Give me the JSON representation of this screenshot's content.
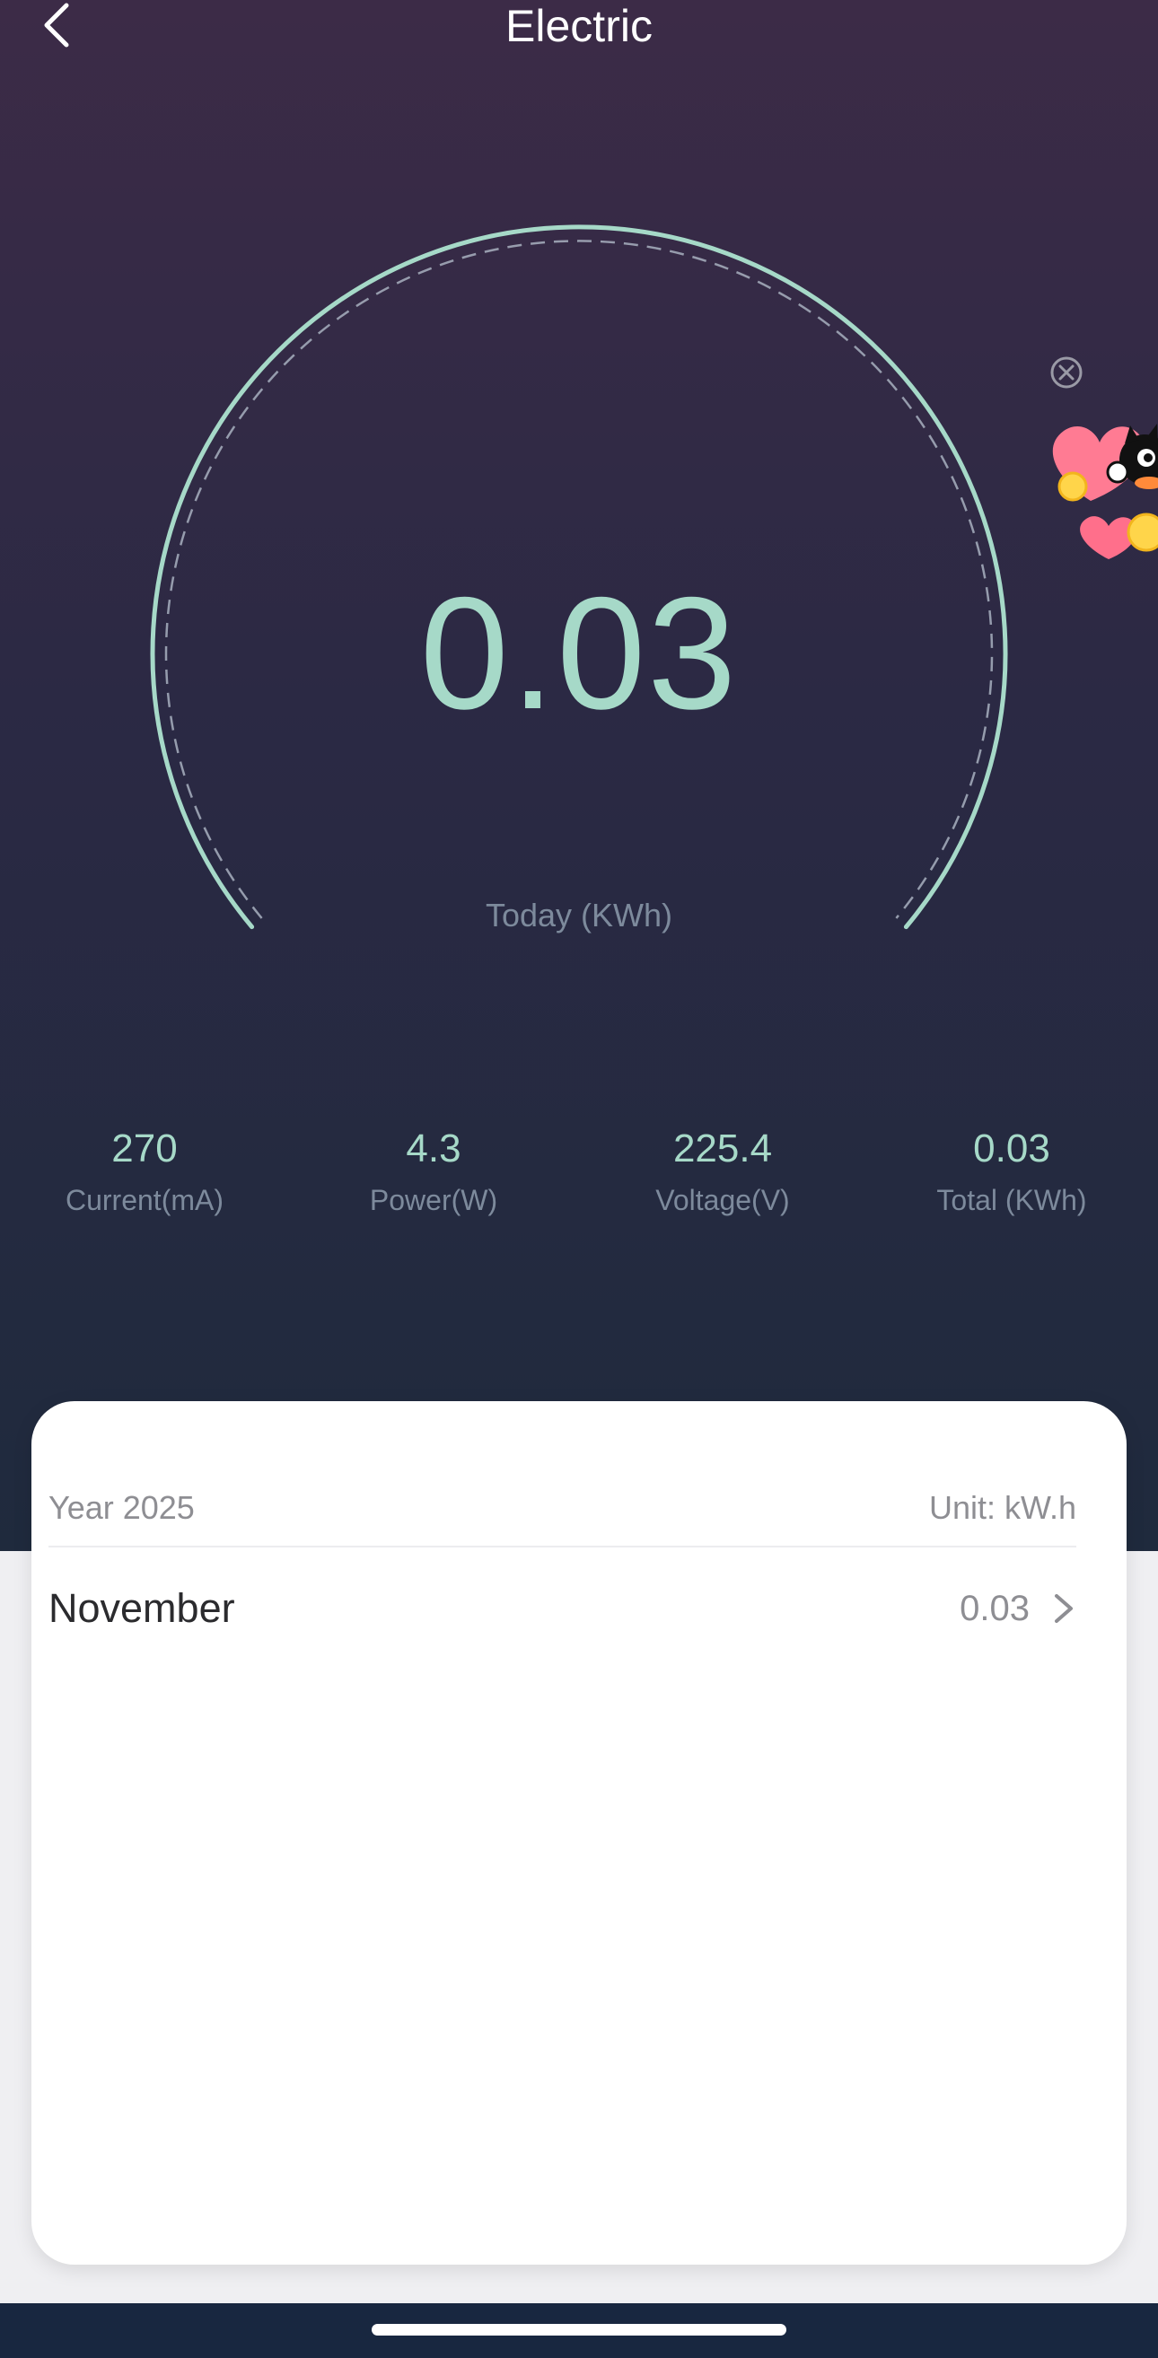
{
  "header": {
    "title": "Electric",
    "back_icon": "chevron-left-icon"
  },
  "gauge": {
    "value": "0.03",
    "caption": "Today (KWh)",
    "accent_color": "#a6d9c8"
  },
  "stats": [
    {
      "value": "270",
      "label": "Current(mA)"
    },
    {
      "value": "4.3",
      "label": "Power(W)"
    },
    {
      "value": "225.4",
      "label": "Voltage(V)"
    },
    {
      "value": "0.03",
      "label": "Total (KWh)"
    }
  ],
  "promo": {
    "close_icon": "close-circle-icon",
    "badge_icon": "cat-hearts-coins-icon"
  },
  "history": {
    "year_label": "Year 2025",
    "unit_label": "Unit: kW.h",
    "rows": [
      {
        "month": "November",
        "value": "0.03",
        "icon": "chevron-right-icon"
      }
    ]
  }
}
